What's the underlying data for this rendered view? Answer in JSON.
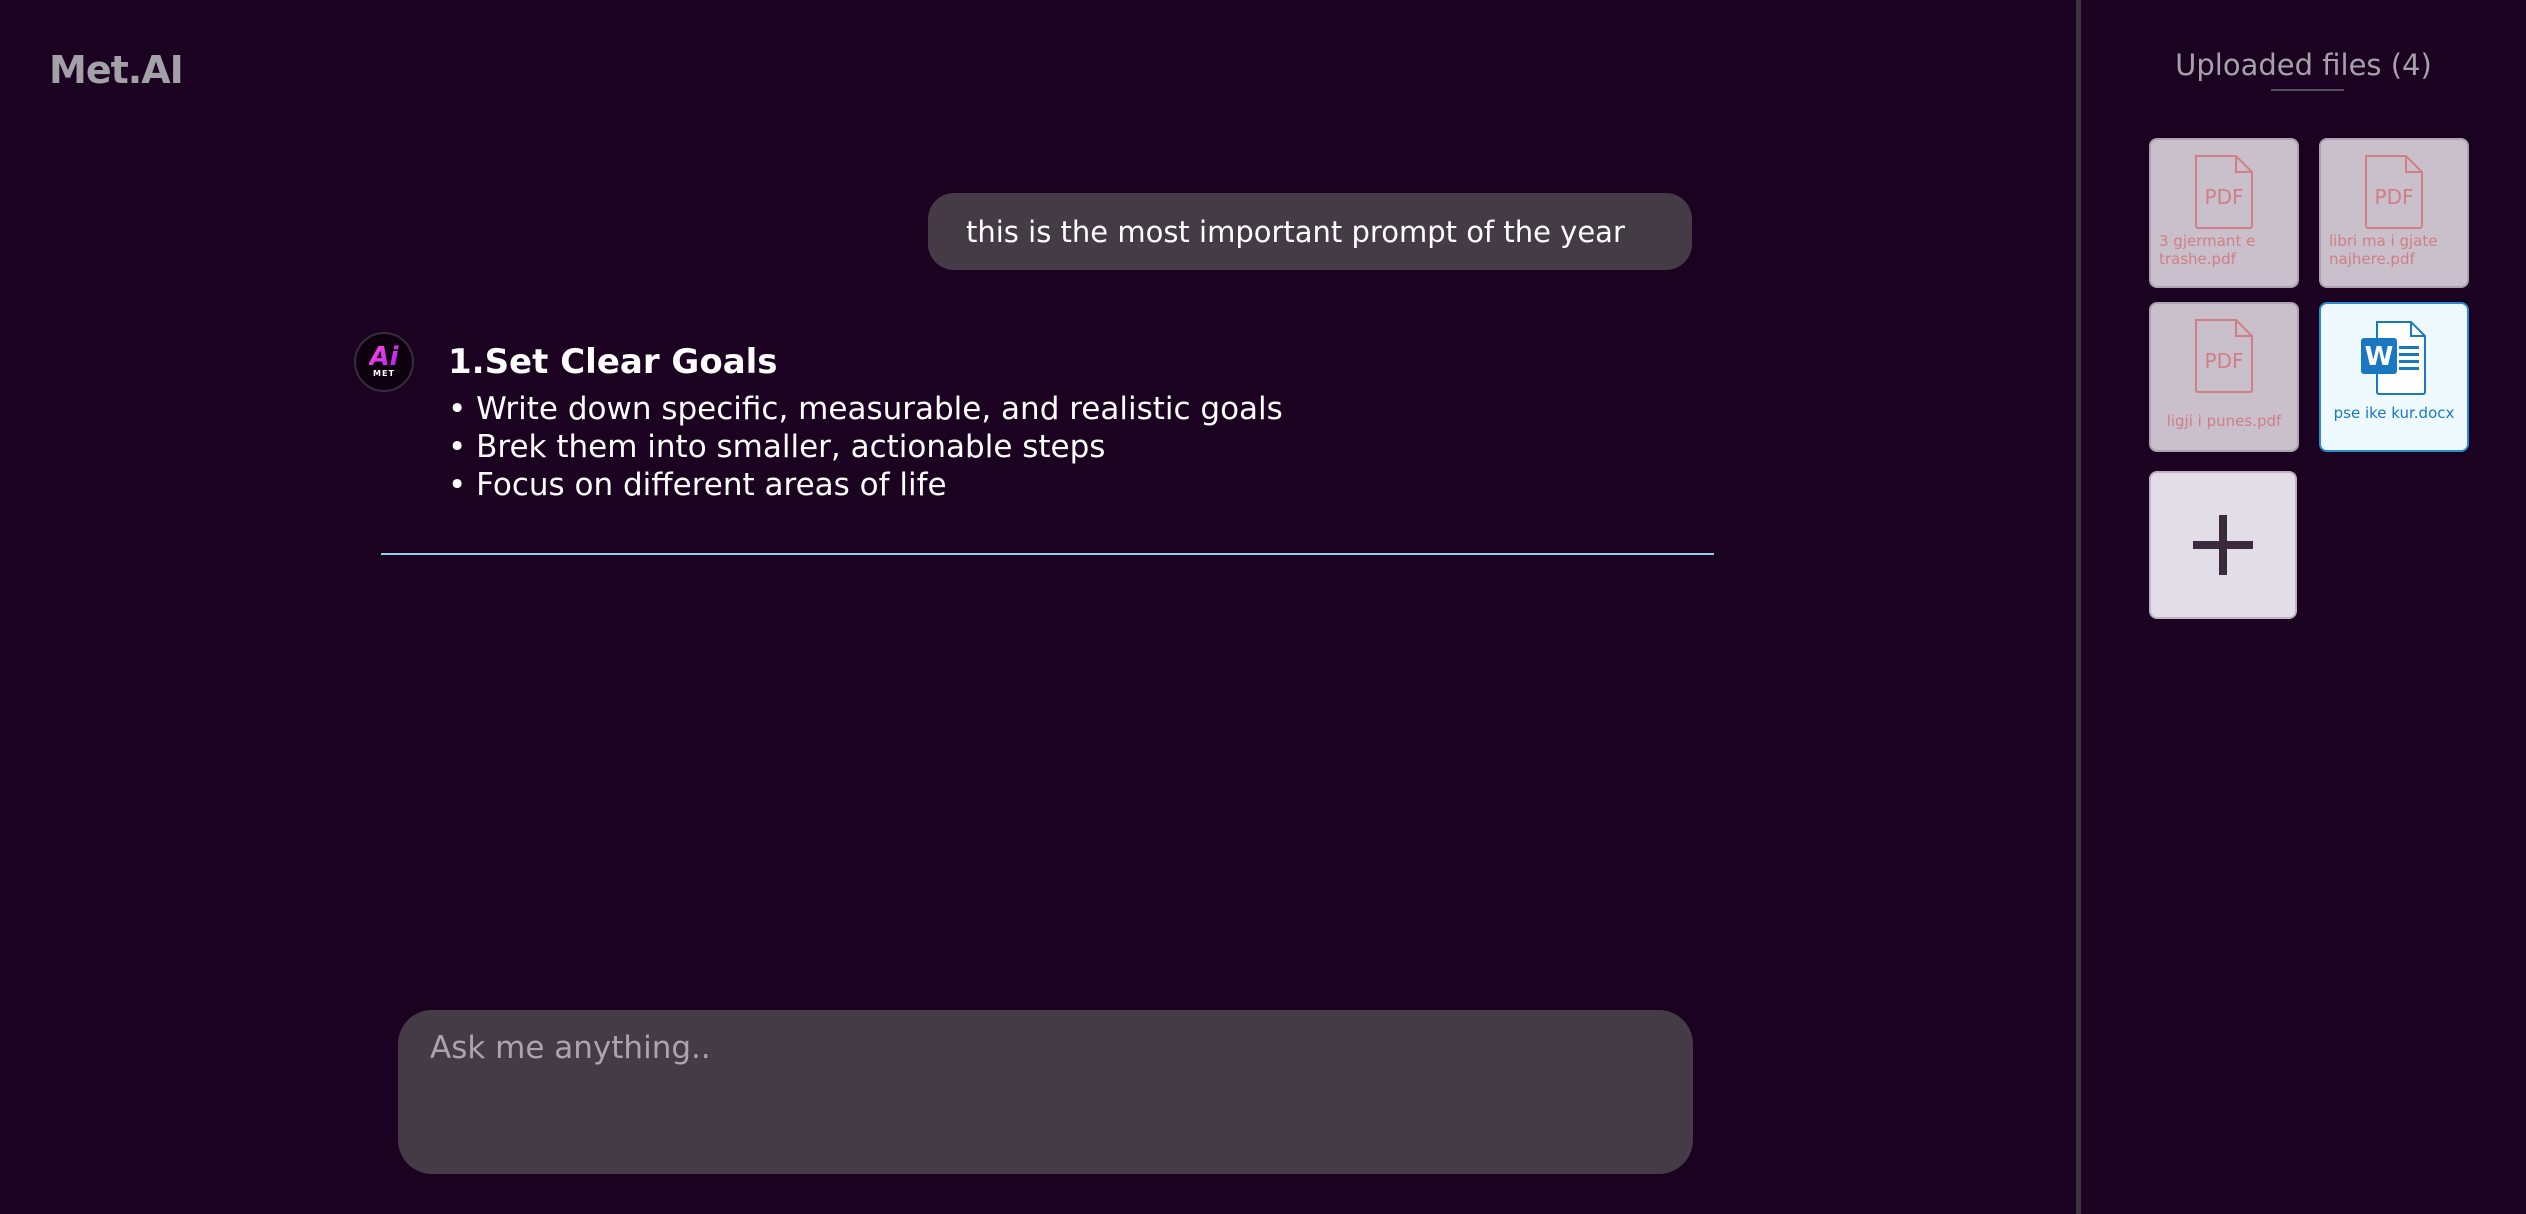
{
  "app": {
    "logo": "Met.AI"
  },
  "chat": {
    "user_message": "this is the most important prompt of the year",
    "assistant": {
      "avatar_mark": "Ai",
      "avatar_sub": "MET",
      "heading": "1.Set Clear Goals",
      "bullets": [
        "Write down specific, measurable, and realistic goals",
        "Brek them into smaller, actionable steps",
        "Focus on different areas of life"
      ]
    }
  },
  "input": {
    "placeholder": "Ask me anything.."
  },
  "sidebar": {
    "title": "Uploaded files (4)",
    "files": [
      {
        "name": "3 gjermant e trashe.pdf",
        "type": "pdf",
        "icon": "pdf-file-icon",
        "icon_label": "PDF"
      },
      {
        "name": "libri ma i gjate najhere.pdf",
        "type": "pdf",
        "icon": "pdf-file-icon",
        "icon_label": "PDF"
      },
      {
        "name": "ligji i punes.pdf",
        "type": "pdf",
        "icon": "pdf-file-icon",
        "icon_label": "PDF"
      },
      {
        "name": "pse ike kur.docx",
        "type": "docx",
        "icon": "word-file-icon",
        "icon_label": "W"
      }
    ],
    "add_button": "+"
  },
  "colors": {
    "background": "#1a0220",
    "bubble": "#443b47",
    "divider": "#8fd3e4",
    "pdf_accent": "#e08a8e",
    "word_accent": "#1a78c2"
  }
}
